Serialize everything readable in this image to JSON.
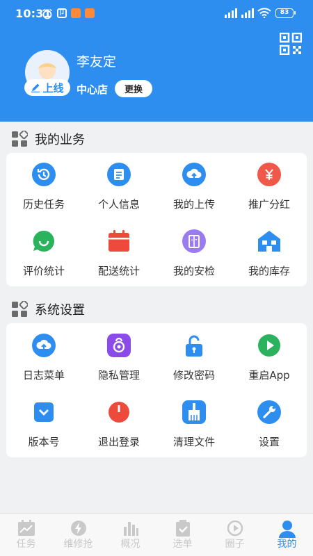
{
  "status_bar": {
    "time": "10:31",
    "battery": "83"
  },
  "profile": {
    "name": "李友定",
    "online_label": "上线",
    "store": "中心店",
    "switch_label": "更换"
  },
  "business": {
    "title": "我的业务",
    "items": [
      {
        "label": "历史任务",
        "icon": "history-icon",
        "color": "#2d8ef0"
      },
      {
        "label": "个人信息",
        "icon": "profile-card-icon",
        "color": "#2d8ef0"
      },
      {
        "label": "我的上传",
        "icon": "cloud-upload-icon",
        "color": "#2d8ef0"
      },
      {
        "label": "推广分红",
        "icon": "yen-icon",
        "color": "#f0584a"
      },
      {
        "label": "评价统计",
        "icon": "smile-chat-icon",
        "color": "#2ab35c"
      },
      {
        "label": "配送统计",
        "icon": "calendar-icon",
        "color": "#ee4a3b"
      },
      {
        "label": "我的安检",
        "icon": "elevator-icon",
        "color": "#9b7bf0"
      },
      {
        "label": "我的库存",
        "icon": "warehouse-icon",
        "color": "#2d8ef0"
      }
    ]
  },
  "settings": {
    "title": "系统设置",
    "items": [
      {
        "label": "日志菜单",
        "icon": "cloud-upload-icon",
        "color": "#2d8ef0"
      },
      {
        "label": "隐私管理",
        "icon": "privacy-icon",
        "color": "#8a4be8"
      },
      {
        "label": "修改密码",
        "icon": "lock-icon",
        "color": "#2d8ef0"
      },
      {
        "label": "重启App",
        "icon": "play-icon",
        "color": "#2ab35c"
      },
      {
        "label": "版本号",
        "icon": "version-icon",
        "color": "#2d8ef0"
      },
      {
        "label": "退出登录",
        "icon": "power-icon",
        "color": "#ee4a3b"
      },
      {
        "label": "清理文件",
        "icon": "broom-icon",
        "color": "#2d8ef0"
      },
      {
        "label": "设置",
        "icon": "wrench-icon",
        "color": "#2d8ef0"
      }
    ]
  },
  "tabs": [
    {
      "label": "任务",
      "icon": "task-chart-icon",
      "active": false
    },
    {
      "label": "维修抢",
      "icon": "lightning-icon",
      "active": false
    },
    {
      "label": "概况",
      "icon": "bar-chart-icon",
      "active": false
    },
    {
      "label": "选单",
      "icon": "clipboard-check-icon",
      "active": false
    },
    {
      "label": "圈子",
      "icon": "circle-play-icon",
      "active": false
    },
    {
      "label": "我的",
      "icon": "person-icon",
      "active": true
    }
  ],
  "colors": {
    "primary": "#2d8ef0",
    "background": "#f0f1f3",
    "inactive_tab": "#c9c9c9"
  }
}
